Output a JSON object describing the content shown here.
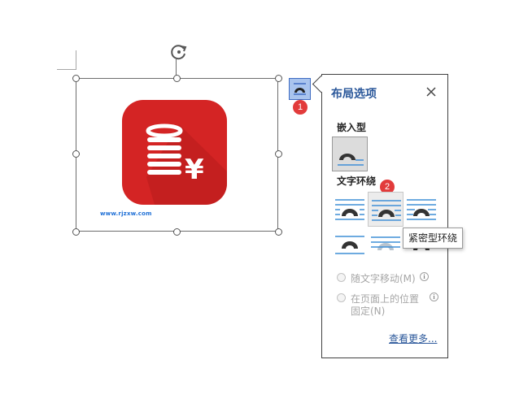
{
  "image": {
    "watermark": "www.rjzxw.com"
  },
  "layout_button": {
    "badge": "1"
  },
  "panel": {
    "title": "布局选项",
    "inline_section": "嵌入型",
    "wrap_section": "文字环绕",
    "wrap_badge": "2",
    "tooltip": "紧密型环绕",
    "radio_move": "随文字移动(M)",
    "radio_fix_line1": "在页面上的位置",
    "radio_fix_line2": "固定(N)",
    "see_more": "查看更多..."
  },
  "colors": {
    "accent": "#2a579a",
    "badge": "#e23b3b",
    "icon_bg": "#d42424"
  }
}
